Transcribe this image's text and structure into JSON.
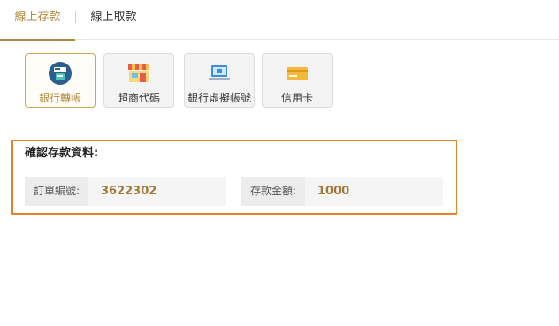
{
  "tabs": [
    {
      "label": "線上存款",
      "active": true
    },
    {
      "label": "線上取款",
      "active": false
    }
  ],
  "payment_methods": [
    {
      "label": "銀行轉帳",
      "icon": "atm-card-icon",
      "selected": true
    },
    {
      "label": "超商代碼",
      "icon": "convenience-store-icon",
      "selected": false
    },
    {
      "label": "銀行虛擬帳號",
      "icon": "laptop-bank-icon",
      "selected": false
    },
    {
      "label": "信用卡",
      "icon": "credit-card-icon",
      "selected": false
    }
  ],
  "confirm": {
    "title": "確認存款資料:",
    "order_label": "訂單編號:",
    "order_value": "3622302",
    "amount_label": "存款金額:",
    "amount_value": "1000"
  },
  "colors": {
    "accent": "#b08a3e",
    "highlight": "#e8822e",
    "field_bg": "#f5f5f5"
  }
}
